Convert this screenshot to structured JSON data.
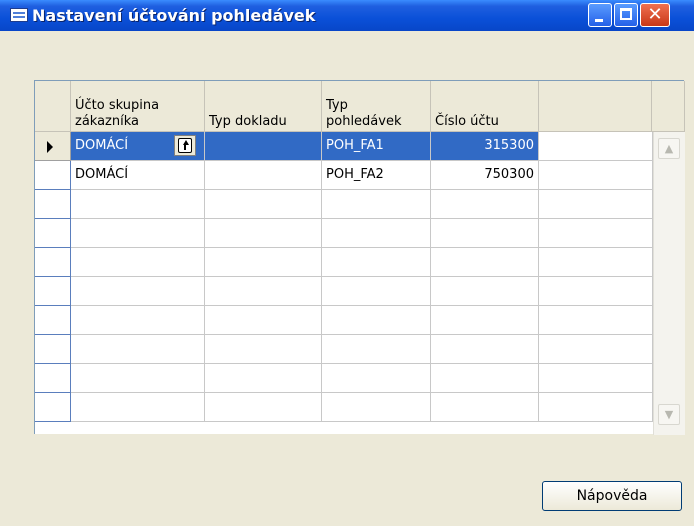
{
  "window": {
    "title": "Nastavení účtování pohledávek"
  },
  "table": {
    "headers": [
      "Účto skupina\nzákazníka",
      "Typ dokladu",
      "Typ\npohledávek",
      "Číslo účtu"
    ],
    "rows": [
      {
        "customer_group": "DOMÁCÍ",
        "doc_type": "",
        "receivable_type": "POH_FA1",
        "account": "315300"
      },
      {
        "customer_group": "DOMÁCÍ",
        "doc_type": "",
        "receivable_type": "POH_FA2",
        "account": "750300"
      }
    ],
    "selected_row": 0
  },
  "buttons": {
    "help": "Nápověda"
  },
  "colors": {
    "titlebar": "#0a50d8",
    "selection": "#316ac5",
    "dialog_bg": "#ece9d8"
  },
  "icons": [
    "window-icon",
    "minimize-icon",
    "maximize-icon",
    "close-icon",
    "row-pointer-icon",
    "lookup-arrow-icon",
    "scroll-up-icon",
    "scroll-down-icon"
  ]
}
